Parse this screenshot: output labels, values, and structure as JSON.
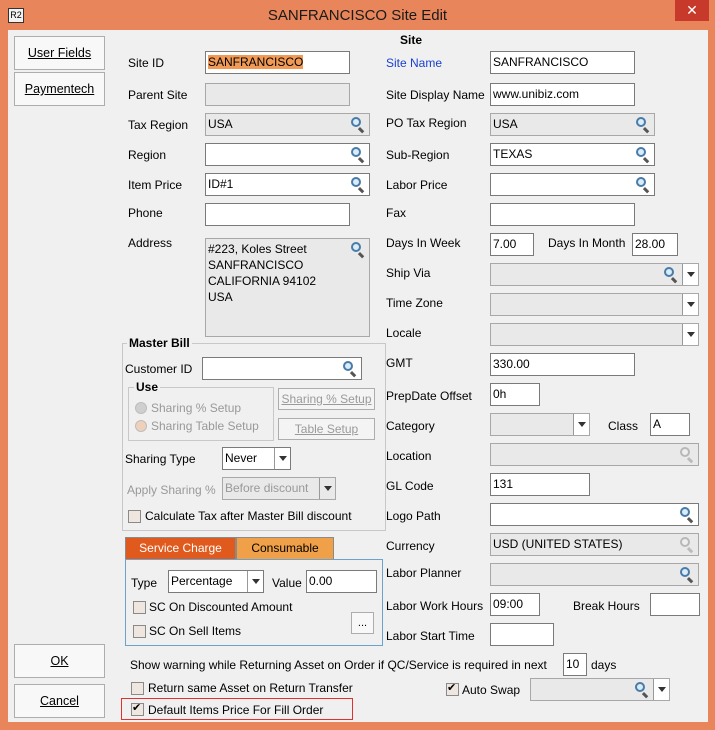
{
  "window": {
    "title": "SANFRANCISCO Site Edit",
    "logo": "R2",
    "close_glyph": "✕"
  },
  "left_nav": {
    "user_fields": "User Fields",
    "paymentech": "Paymentech",
    "ok": "OK",
    "cancel": "Cancel"
  },
  "section_title": "Site",
  "site_id": {
    "label": "Site ID",
    "value": "SANFRANCISCO"
  },
  "site_name": {
    "label": "Site Name",
    "value": "SANFRANCISCO"
  },
  "parent_site": {
    "label": "Parent Site",
    "value": ""
  },
  "site_display_name": {
    "label": "Site Display Name",
    "value": "www.unibiz.com"
  },
  "tax_region": {
    "label": "Tax Region",
    "value": "USA"
  },
  "po_tax_region": {
    "label": "PO Tax Region",
    "value": "USA"
  },
  "region": {
    "label": "Region",
    "value": ""
  },
  "sub_region": {
    "label": "Sub-Region",
    "value": "TEXAS"
  },
  "item_price": {
    "label": "Item Price",
    "value": "ID#1"
  },
  "labor_price": {
    "label": "Labor Price",
    "value": ""
  },
  "phone": {
    "label": "Phone",
    "value": ""
  },
  "fax": {
    "label": "Fax",
    "value": ""
  },
  "address": {
    "label": "Address",
    "lines": [
      "#223, Koles Street",
      "SANFRANCISCO",
      "CALIFORNIA 94102",
      "USA"
    ]
  },
  "days_in_week": {
    "label": "Days In Week",
    "value": "7.00"
  },
  "days_in_month": {
    "label": "Days In Month",
    "value": "28.00"
  },
  "ship_via": {
    "label": "Ship Via",
    "value": ""
  },
  "time_zone": {
    "label": "Time Zone",
    "value": ""
  },
  "locale": {
    "label": "Locale",
    "value": ""
  },
  "gmt": {
    "label": "GMT",
    "value": "330.00"
  },
  "prepdate_offset": {
    "label": "PrepDate Offset",
    "value": "0h"
  },
  "category": {
    "label": "Category",
    "value": ""
  },
  "class": {
    "label": "Class",
    "value": "A"
  },
  "location": {
    "label": "Location",
    "value": ""
  },
  "gl_code": {
    "label": "GL Code",
    "value": "131"
  },
  "logo_path": {
    "label": "Logo Path",
    "value": ""
  },
  "currency": {
    "label": "Currency",
    "value": "USD (UNITED STATES)"
  },
  "labor_planner": {
    "label": "Labor Planner",
    "value": ""
  },
  "labor_work_hours": {
    "label": "Labor Work Hours",
    "value": "09:00"
  },
  "break_hours": {
    "label": "Break Hours",
    "value": ""
  },
  "labor_start_time": {
    "label": "Labor Start Time",
    "value": ""
  },
  "master_bill": {
    "title": "Master Bill",
    "customer_id_label": "Customer ID",
    "customer_id_value": "",
    "use_title": "Use",
    "sharing_pct_setup": "Sharing % Setup",
    "sharing_table_setup": "Sharing Table Setup",
    "sharing_pct_setup_btn": "Sharing % Setup",
    "table_setup_btn": "Table Setup",
    "sharing_type_label": "Sharing Type",
    "sharing_type_value": "Never",
    "apply_sharing_label": "Apply Sharing %",
    "apply_sharing_value": "Before discount",
    "calc_tax_label": "Calculate Tax after Master Bill discount"
  },
  "tabs": {
    "service_charge": "Service Charge",
    "consumable": "Consumable"
  },
  "service_charge": {
    "type_label": "Type",
    "type_value": "Percentage",
    "value_label": "Value",
    "value_value": "0.00",
    "sc_discounted": "SC On Discounted Amount",
    "sc_sell_items": "SC On Sell Items",
    "ellipsis": "..."
  },
  "warning": {
    "text_before": "Show warning while Returning Asset on Order if QC/Service is required in next",
    "days_value": "10",
    "text_after": "days"
  },
  "return_same_asset": "Return same Asset on Return Transfer",
  "auto_swap": {
    "label": "Auto Swap",
    "checked": true,
    "value": ""
  },
  "default_items_price": {
    "label": "Default Items Price For Fill Order",
    "checked": true
  },
  "colors": {
    "title_bar": "#e8855a",
    "highlight": "#f19a56",
    "close": "#c7392b",
    "tab_active": "#e05a1e",
    "tab_inactive": "#f0a048",
    "link_label": "#1a3fcf",
    "alert_border": "#e03030"
  }
}
